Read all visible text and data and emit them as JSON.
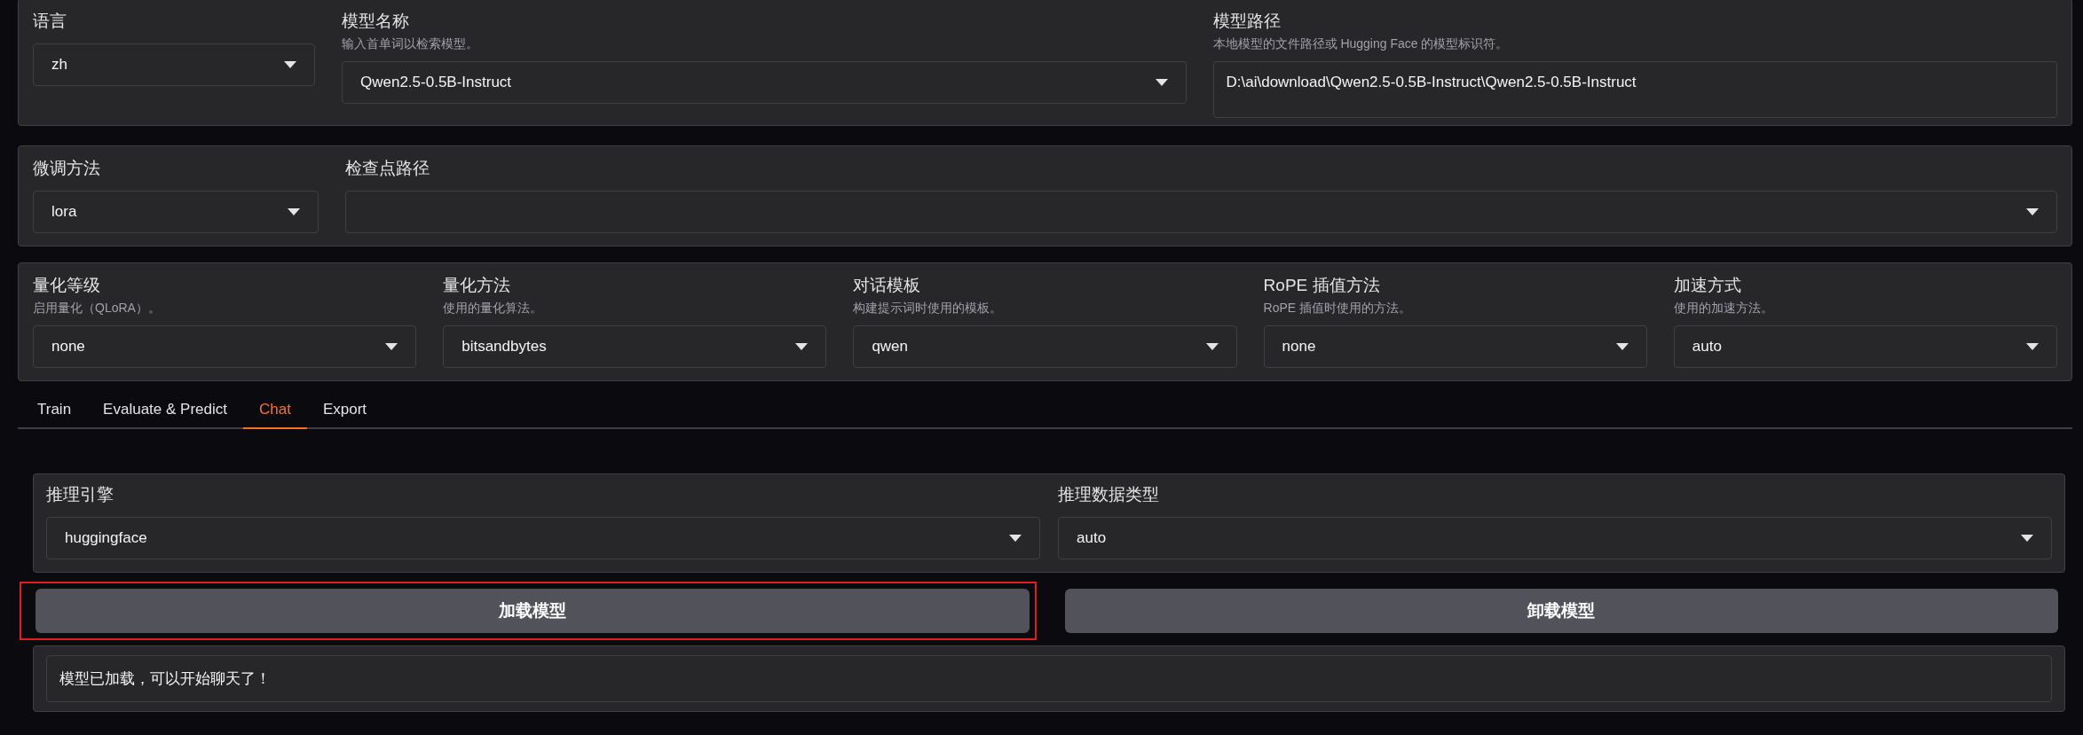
{
  "sections": [
    {
      "fields": [
        {
          "kind": "dropdown",
          "label": "语言",
          "value": "zh"
        },
        {
          "kind": "dropdown",
          "label": "模型名称",
          "hint": "输入首单词以检索模型。",
          "value": "Qwen2.5-0.5B-Instruct"
        },
        {
          "kind": "textbox",
          "label": "模型路径",
          "hint": "本地模型的文件路径或 Hugging Face 的模型标识符。",
          "value": "D:\\ai\\download\\Qwen2.5-0.5B-Instruct\\Qwen2.5-0.5B-Instruct"
        }
      ]
    },
    {
      "fields": [
        {
          "kind": "dropdown",
          "label": "微调方法",
          "value": "lora"
        },
        {
          "kind": "dropdown",
          "label": "检查点路径"
        }
      ]
    },
    {
      "fields": [
        {
          "kind": "dropdown",
          "label": "量化等级",
          "hint": "启用量化（QLoRA）。",
          "value": "none"
        },
        {
          "kind": "dropdown",
          "label": "量化方法",
          "hint": "使用的量化算法。",
          "value": "bitsandbytes"
        },
        {
          "kind": "dropdown",
          "label": "对话模板",
          "hint": "构建提示词时使用的模板。",
          "value": "qwen"
        },
        {
          "kind": "dropdown",
          "label": "RoPE 插值方法",
          "hint": "RoPE 插值时使用的方法。",
          "value": "none"
        },
        {
          "kind": "dropdown",
          "label": "加速方式",
          "hint": "使用的加速方法。",
          "value": "auto"
        }
      ]
    }
  ],
  "tabs": [
    {
      "label": "Train",
      "selected": false
    },
    {
      "label": "Evaluate & Predict",
      "selected": false
    },
    {
      "label": "Chat",
      "selected": true
    },
    {
      "label": "Export",
      "selected": false
    }
  ],
  "chat": {
    "fields": [
      {
        "kind": "dropdown",
        "label": "推理引擎",
        "value": "huggingface"
      },
      {
        "kind": "dropdown",
        "label": "推理数据类型",
        "value": "auto"
      }
    ],
    "buttons": [
      {
        "label": "加载模型",
        "highlighted": true
      },
      {
        "label": "卸载模型",
        "highlighted": false
      }
    ],
    "status": "模型已加载，可以开始聊天了！"
  }
}
